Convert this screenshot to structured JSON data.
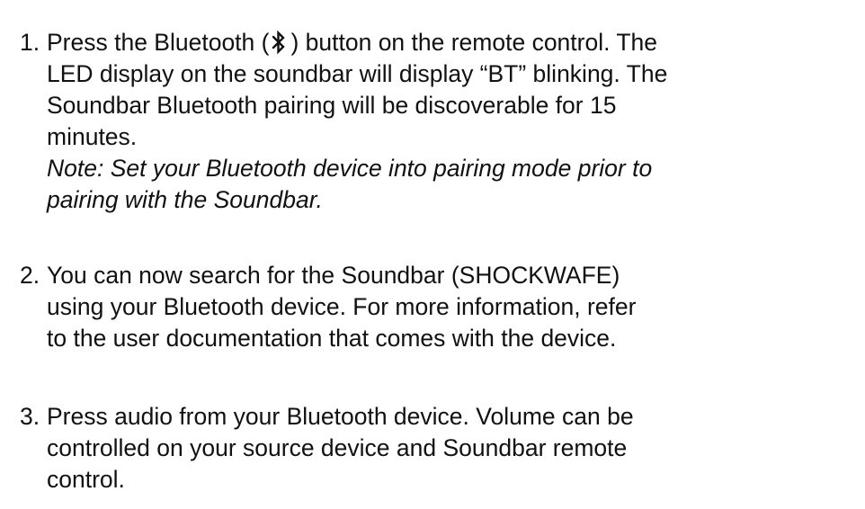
{
  "steps": [
    {
      "number": "1.",
      "line1_before_icon": "Press the Bluetooth (",
      "bluetooth_icon": "bluetooth-icon",
      "line1_after_icon": ") button on the remote control. The",
      "lines": [
        "LED display on the soundbar will display “BT” blinking. The",
        "Soundbar Bluetooth pairing will be discoverable for 15",
        "minutes."
      ],
      "note_lines": [
        "Note: Set your Bluetooth device into pairing mode prior to",
        "pairing with the Soundbar."
      ]
    },
    {
      "number": "2.",
      "lines": [
        "You can now search for the Soundbar (SHOCKWAFE)",
        "using your Bluetooth device. For more information, refer",
        "to the user documentation that comes with the device."
      ]
    },
    {
      "number": "3.",
      "lines": [
        "Press audio from your Bluetooth device. Volume can be",
        "controlled on your source device and Soundbar remote",
        "control."
      ]
    }
  ]
}
